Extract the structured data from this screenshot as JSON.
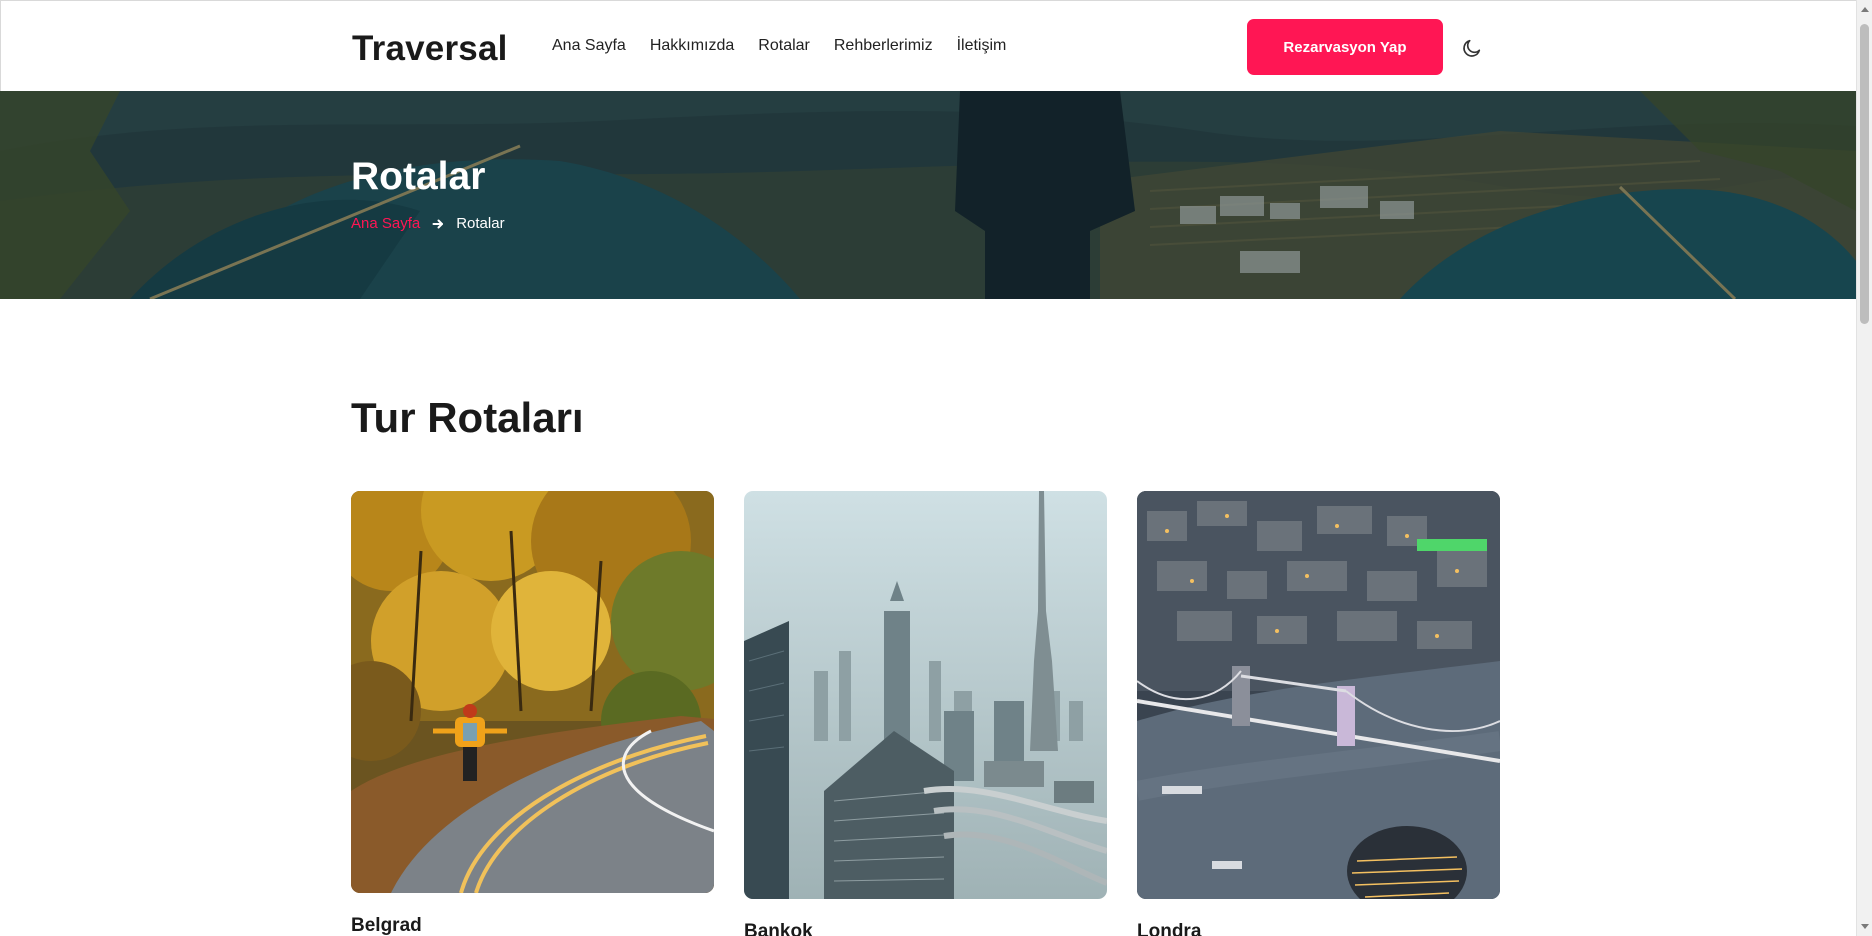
{
  "header": {
    "brand": "Traversal",
    "nav": [
      "Ana Sayfa",
      "Hakkımızda",
      "Rotalar",
      "Rehberlerimiz",
      "İletişim"
    ],
    "cta_label": "Rezarvasyon Yap",
    "theme_icon": "moon-icon"
  },
  "hero": {
    "title": "Rotalar",
    "breadcrumb": {
      "home": "Ana Sayfa",
      "separator_icon": "arrow-right-icon",
      "current": "Rotalar"
    }
  },
  "section": {
    "title": "Tur Rotaları",
    "cards": [
      {
        "label": "Belgrad"
      },
      {
        "label": "Bankok"
      },
      {
        "label": "Londra"
      }
    ]
  },
  "colors": {
    "accent": "#ff1654",
    "text": "#1a1a1a"
  }
}
